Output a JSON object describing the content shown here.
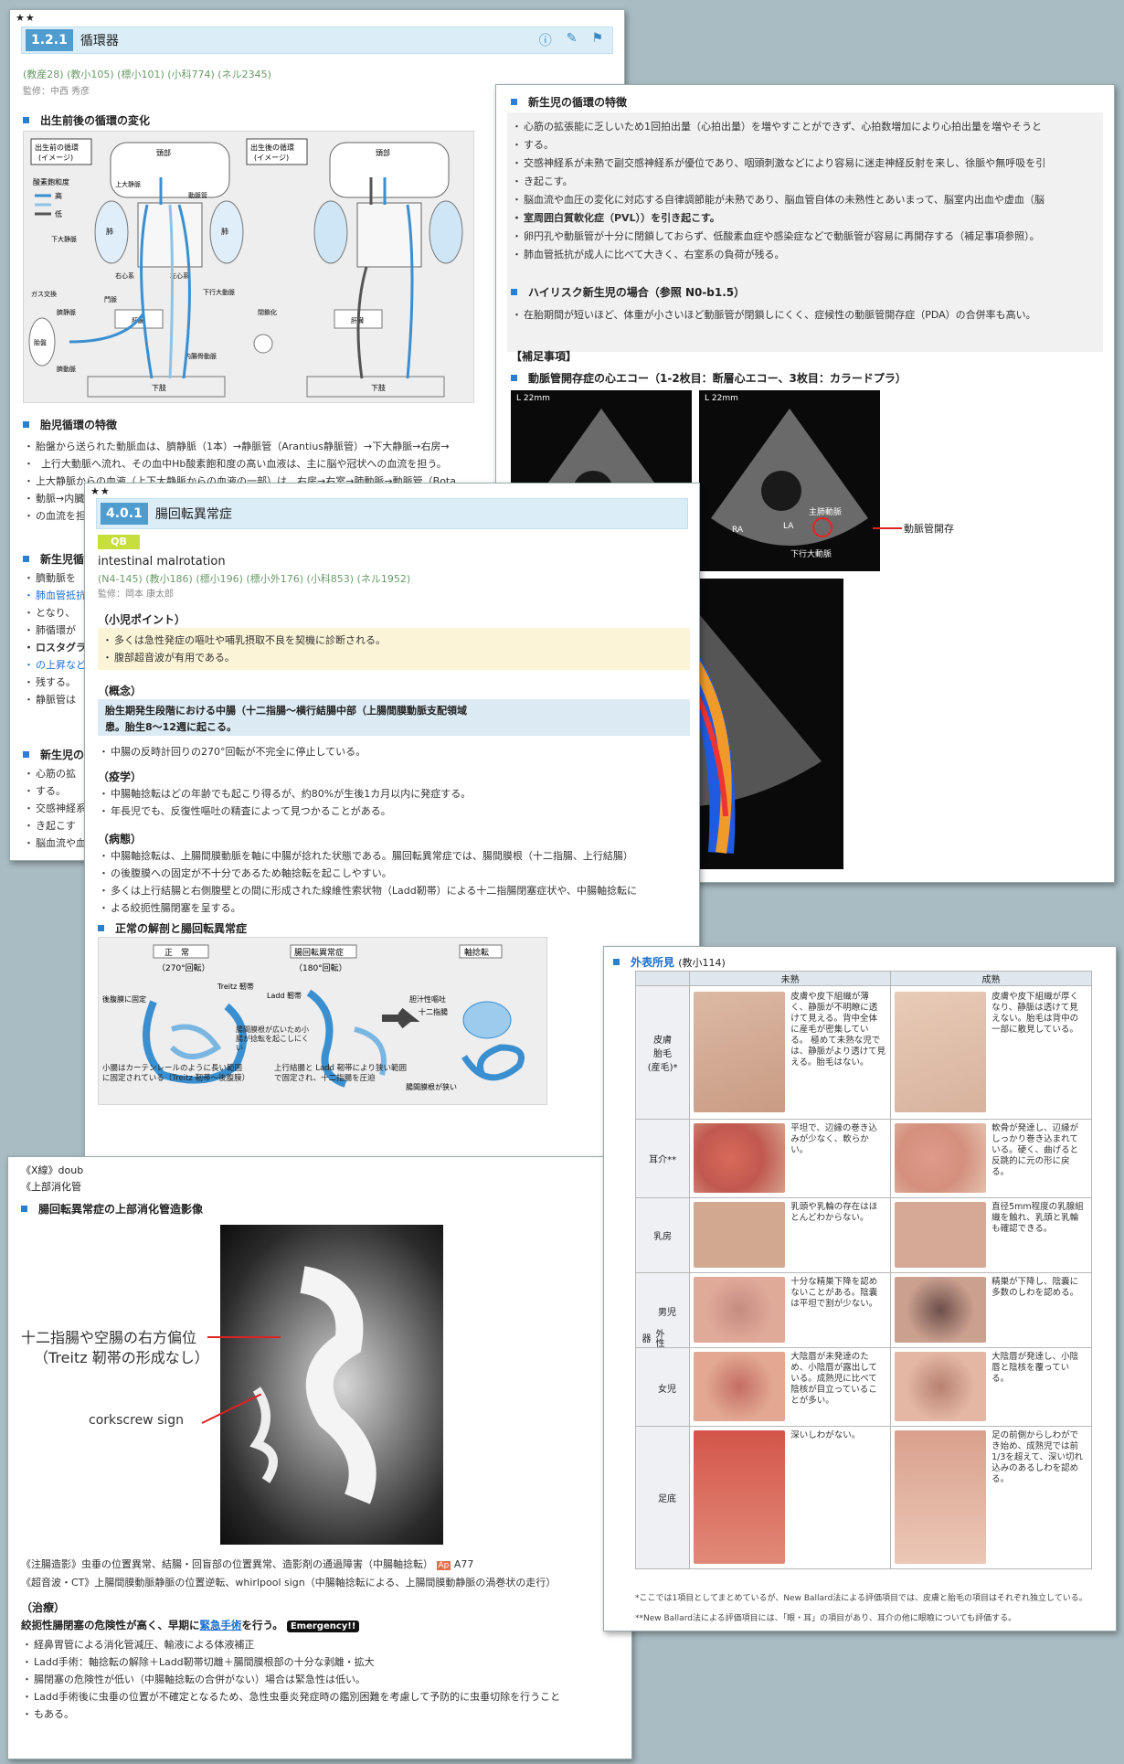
{
  "panel1": {
    "stars": "★★",
    "num": "1.2.1",
    "title": "循環器",
    "refs": "(教産28) (教小105) (標小101) (小科774) (ネル2345)",
    "supervisor": "監修：中西 秀彦",
    "sec1": "出生前後の循環の変化",
    "diagram": {
      "left_label1": "出生前の循環",
      "left_label2": "(イメージ)",
      "right_label1": "出生後の循環",
      "right_label2": "(イメージ)",
      "o2": "酸素飽和度",
      "high": "高",
      "low": "低",
      "head": "頭部",
      "lung": "肺",
      "svc": "上大静脈",
      "ivc": "下大静脈",
      "da": "動脈管",
      "ra": "右心系",
      "la": "左心系",
      "liver": "肝臓",
      "placenta": "胎盤",
      "gas": "ガス交換",
      "lower": "下肢",
      "portal": "門脈",
      "umbv": "臍静脈",
      "umba": "臍動脈",
      "closed": "閉鎖化",
      "aorta": "下行大動脈",
      "iliac": "内腸骨動脈"
    },
    "sec2": "胎児循環の特徴",
    "fetal_items": [
      "胎盤から送られた動脈血は、臍静脈（1本）→静脈管（Arantius静脈管）→下大静脈→右房→",
      "上行大動脈へ流れ、その血中Hb酸素飽和度の高い血液は、主に脳や冠状への血流を担う。",
      "上大静脈からの血液（上下大静脈からの血液の一部）は、右房→右室→肺動脈→動脈管（Bota",
      "動脈→内臓",
      "の血流を担"
    ],
    "sec3": "新生児循",
    "left_frag": [
      "臍動脈を",
      "肺血管抵抗",
      "となり、",
      "肺循環が",
      "ロスタグラ",
      "の上昇など",
      "残する。",
      "静脈管は"
    ],
    "sec4": "新生児の",
    "left_frag2": [
      "心筋の拡",
      "する。",
      "交感神経系",
      "き起こす",
      "脳血流や血"
    ]
  },
  "panel2": {
    "sec1": "新生児の循環の特徴",
    "items": [
      "心筋の拡張能に乏しいため1回拍出量（心拍出量）を増やすことができず、心拍数増加により心拍出量を増やそうと",
      "する。",
      "交感神経系が未熟で副交感神経系が優位であり、咽頭刺激などにより容易に迷走神経反射を来し、徐脈や無呼吸を引",
      "き起こす。",
      "脳血流や血圧の変化に対応する自律調節能が未熟であり、脳血管自体の未熟性とあいまって、脳室内出血や虚血（脳",
      "室周囲白質軟化症（PVL））を引き起こす。",
      "卵円孔や動脈管が十分に閉鎖しておらず、低酸素血症や感染症などで動脈管が容易に再開存する（補足事項参照）。",
      "肺血管抵抗が成人に比べて大きく、右室系の負荷が残る。"
    ],
    "sec2": "ハイリスク新生児の場合（参照 N0-b1.5）",
    "item2": "在胎期間が短いほど、体重が小さいほど動脈管が閉鎖しにくく、症候性の動脈管開存症（PDA）の合併率も高い。",
    "supp": "【補足事項】",
    "sec3": "動脈管開存症の心エコー（1-2枚目：断層心エコー、3枚目：カラードプラ）",
    "echo_labels": {
      "depth": "L 22mm",
      "pa": "主肺動脈",
      "ra": "RA",
      "la": "LA",
      "ao": "下行大動脈",
      "annot": "動脈管開存"
    }
  },
  "panel3": {
    "stars": "★★",
    "num": "4.0.1",
    "title": "腸回転異常症",
    "qb": "QB",
    "en": "intestinal malrotation",
    "refs": "(N4-145) (教小186) (標小196) (標小外176) (小科853) (ネル1952)",
    "supervisor": "監修：岡本 康太郎",
    "point_title": "（小児ポイント）",
    "points": [
      "多くは急性発症の嘔吐や哺乳摂取不良を契機に診断される。",
      "腹部超音波が有用である。"
    ],
    "concept_title": "（概念）",
    "concept1": "胎生期発生段階における中腸（十二指腸～横行結腸中部（上腸間膜動脈支配領域",
    "concept2": "患。胎生8～12週に起こる。",
    "concept_item": "中腸の反時計回りの270°回転が不完全に停止している。",
    "epi_title": "（疫学）",
    "epi": [
      "中腸軸捻転はどの年齢でも起こり得るが、約80%が生後1カ月以内に発症する。",
      "年長児でも、反復性嘔吐の精査によって見つかることがある。"
    ],
    "path_title": "（病態）",
    "path": [
      "中腸軸捻転は、上腸間膜動脈を軸に中腸が捻れた状態である。腸回転異常症では、腸間膜根（十二指腸、上行結腸）",
      "の後腹膜への固定が不十分であるため軸捻転を起こしやすい。",
      "多くは上行結腸と右側腹壁との間に形成された線維性索状物（Ladd靭帯）による十二指腸閉塞症状や、中腸軸捻転に",
      "よる絞扼性腸閉塞を呈する。"
    ],
    "fig_title": "正常の解剖と腸回転異常症",
    "fig": {
      "normal": "正　常",
      "normal_sub": "（270°回転）",
      "abn": "腸回転異常症",
      "abn_sub": "（180°回転）",
      "volvulus": "軸捻転",
      "treitz": "Treitz 靭帯",
      "ladd": "Ladd 靭帯",
      "retro": "後腹膜に固定",
      "mesentery": "腸間膜根が広いため小腸が捻転を起こしにくい",
      "narrow": "腸間膜根が狭い",
      "vomit": "胆汁性嘔吐",
      "duod": "十二指腸",
      "note1": "小腸はカーテンレールのように長い範囲に固定されている（Treitz 靭帯～後腹膜）",
      "note2": "上行結腸と Ladd 靭帯により狭い範囲で固定され、十二指腸を圧迫"
    }
  },
  "panel4": {
    "frag1": "《X線》doub",
    "frag2": "《上部消化管",
    "sec": "腸回転異常症の上部消化管造影像",
    "label1a": "十二指腸や空腸の右方偏位",
    "label1b": "（Treitz 靭帯の形成なし）",
    "label2": "corkscrew sign",
    "line1": "《注腸造影》虫垂の位置異常、結腸・回盲部の位置異常、造影剤の通過障害（中腸軸捻転）",
    "link": "A77",
    "line2": "《超音波・CT》上腸間膜動脈静脈の位置逆転、whirlpool sign（中腸軸捻転による、上腸間膜動静脈の渦巻状の走行）",
    "treat_title": "（治療）",
    "treat_main_a": "絞扼性腸閉塞の危険性が高く、早期に",
    "treat_main_link": "緊急手術",
    "treat_main_b": "を行う。",
    "emergency": "Emergency!!",
    "treat_items": [
      "経鼻胃管による消化管減圧、輸液による体液補正",
      "Ladd手術：軸捻転の解除＋Ladd靭帯切離＋腸間膜根部の十分な剥離・拡大",
      "腸閉塞の危険性が低い（中腸軸捻転の合併がない）場合は緊急性は低い。",
      "Ladd手術後に虫垂の位置が不確定となるため、急性虫垂炎発症時の鑑別困難を考慮して予防的に虫垂切除を行うこと",
      "もある。"
    ]
  },
  "panel5": {
    "sec": "外表所見",
    "ref": "(教小114)",
    "col_immature": "未熟",
    "col_mature": "成熟",
    "rows": [
      {
        "label": "皮膚\n胎毛\n(産毛)*",
        "immature": "皮膚や皮下組織が薄く、静脈が不明瞭に透けて見える。背中全体に産毛が密集している。\n極めて未熟な児では、静脈がより透けて見える。胎毛はない。",
        "mature": "皮膚や皮下組織が厚くなり、静脈は透けて見えない。胎毛は背中の一部に散見している。"
      },
      {
        "label": "耳介**",
        "immature": "平坦で、辺縁の巻き込みが少なく、軟らかい。",
        "mature": "軟骨が発達し、辺縁がしっかり巻き込まれている。硬く、曲げると反跳的に元の形に戻る。"
      },
      {
        "label": "乳房",
        "immature": "乳頭や乳輪の存在はほとんどわからない。",
        "mature": "直径5mm程度の乳腺組織を触れ、乳頭と乳輪も確認できる。"
      },
      {
        "label": "男児",
        "immature": "十分な精巣下降を認めないことがある。陰嚢は平坦で割が少ない。",
        "mature": "精巣が下降し、陰嚢に多数のしわを認める。"
      },
      {
        "label": "女児",
        "immature": "大陰唇が未発達のため、小陰唇が露出している。成熟児に比べて陰核が目立っていることが多い。",
        "mature": "大陰唇が発達し、小陰唇と陰核を覆っている。"
      },
      {
        "label": "足底",
        "immature": "深いしわがない。",
        "mature": "足の前側からしわができ始め、成熟児では前1/3を超えて、深い切れ込みのあるしわを認める。"
      }
    ],
    "genital": "外性器",
    "foot1": "*ここでは1項目としてまとめているが、New Ballard法による評価項目では、皮膚と胎毛の項目はそれぞれ独立している。",
    "foot2": "**New Ballard法による評価項目には、「眼・耳」の項目があり、耳介の他に眼瞼についても評価する。"
  }
}
